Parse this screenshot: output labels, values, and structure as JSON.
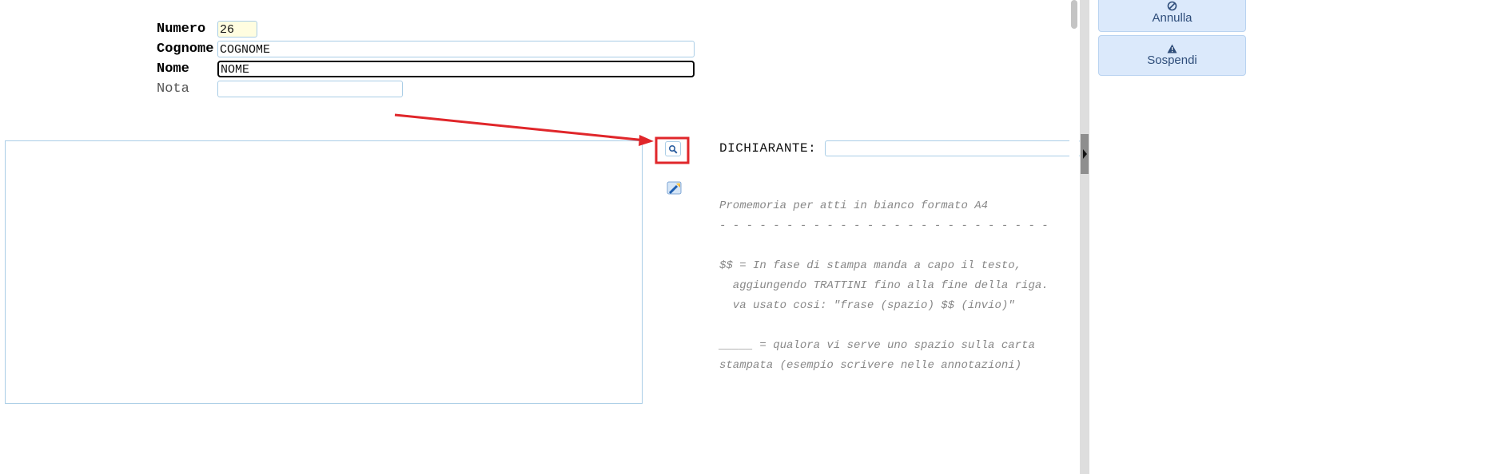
{
  "form": {
    "numero": {
      "label": "Numero",
      "value": "26"
    },
    "cognome": {
      "label": "Cognome",
      "value": "COGNOME"
    },
    "nome": {
      "label": "Nome",
      "value": "NOME"
    },
    "nota": {
      "label": "Nota",
      "value": ""
    }
  },
  "dichiarante": {
    "label": "DICHIARANTE:",
    "value": ""
  },
  "promemoria": {
    "title": "Promemoria per atti in bianco formato A4",
    "separator": "- - - - - - - - - - - - - - - - - - - - - - - - -",
    "line1": "$$ = In fase di stampa manda a capo il testo,",
    "line2": "  aggiungendo TRATTINI fino alla fine della riga.",
    "line3": "  va usato cosi: \"frase (spazio) $$ (invio)\"",
    "line4": "_____ = qualora vi serve uno spazio sulla carta",
    "line5": "stampata (esempio scrivere nelle annotazioni)"
  },
  "sidebar": {
    "annulla": {
      "label": "Annulla",
      "icon": "cancel-icon"
    },
    "sospendi": {
      "label": "Sospendi",
      "icon": "warning-icon"
    }
  },
  "colors": {
    "annotation": "#e0262a",
    "input_border": "#a9cde6",
    "button_bg": "#dbe9fb"
  },
  "icons": {
    "search": "search-icon",
    "wizard": "wizard-icon"
  }
}
